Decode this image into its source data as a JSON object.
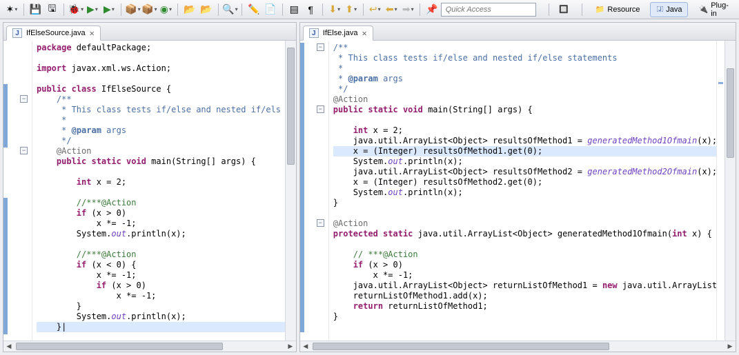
{
  "quick_access_placeholder": "Quick Access",
  "perspectives": {
    "resource": "Resource",
    "java": "Java",
    "plugin": "Plug-in"
  },
  "editors": {
    "left": {
      "tab_label": "IfElseSource.java",
      "code_html": "<span class='kw'>package</span> defaultPackage;\n\n<span class='kw'>import</span> javax.xml.ws.Action;\n\n<span class='kw'>public class</span> IfElseSource {\n    <span class='doc'>/**</span>\n    <span class='doc'> * This class tests if/else and nested if/els</span>\n    <span class='doc'> *</span>\n    <span class='doc'> * <b>@param</b> args</span>\n    <span class='doc'> */</span>\n    <span class='ann'>@Action</span>\n    <span class='kw'>public static void</span> main(String[] args) {\n\n        <span class='kw'>int</span> x = 2;\n\n        <span class='com'>//***@Action</span>\n        <span class='kw'>if</span> (x &gt; 0)\n            x *= -1;\n        System.<span class='st'>out</span>.println(x);\n\n        <span class='com'>//***@Action</span>\n        <span class='kw'>if</span> (x &lt; 0) {\n            x *= -1;\n            <span class='kw'>if</span> (x &gt; 0)\n                x *= -1;\n        }\n        System.<span class='st'>out</span>.println(x);\n<span class='hl'>    }|</span>"
    },
    "right": {
      "tab_label": "IfElse.java",
      "code_html": "<span class='doc'>/**</span>\n<span class='doc'> * This class tests if/else and nested if/else statements</span>\n<span class='doc'> *</span>\n<span class='doc'> * <b>@param</b> args</span>\n<span class='doc'> */</span>\n<span class='ann'>@Action</span>\n<span class='kw'>public static void</span> main(String[] args) {\n\n    <span class='kw'>int</span> x = 2;\n    java.util.ArrayList&lt;Object&gt; resultsOfMethod1 = <span class='st'>generatedMethod1Ofmain</span>(x);\n<span class='hl'>    x = (Integer) resultsOfMethod1.get(0);</span>\n    System.<span class='st'>out</span>.println(x);\n    java.util.ArrayList&lt;Object&gt; resultsOfMethod2 = <span class='st'>generatedMethod2Ofmain</span>(x);\n    x = (Integer) resultsOfMethod2.get(0);\n    System.<span class='st'>out</span>.println(x);\n}\n\n<span class='ann'>@Action</span>\n<span class='kw'>protected static</span> java.util.ArrayList&lt;Object&gt; generatedMethod1Ofmain(<span class='kw'>int</span> x) {\n\n    <span class='com'>// ***@Action</span>\n    <span class='kw'>if</span> (x &gt; 0)\n        x *= -1;\n    java.util.ArrayList&lt;Object&gt; returnListOfMethod1 = <span class='kw'>new</span> java.util.ArrayList&lt;\n    returnListOfMethod1.add(x);\n    <span class='kw'>return</span> returnListOfMethod1;\n}"
    }
  }
}
